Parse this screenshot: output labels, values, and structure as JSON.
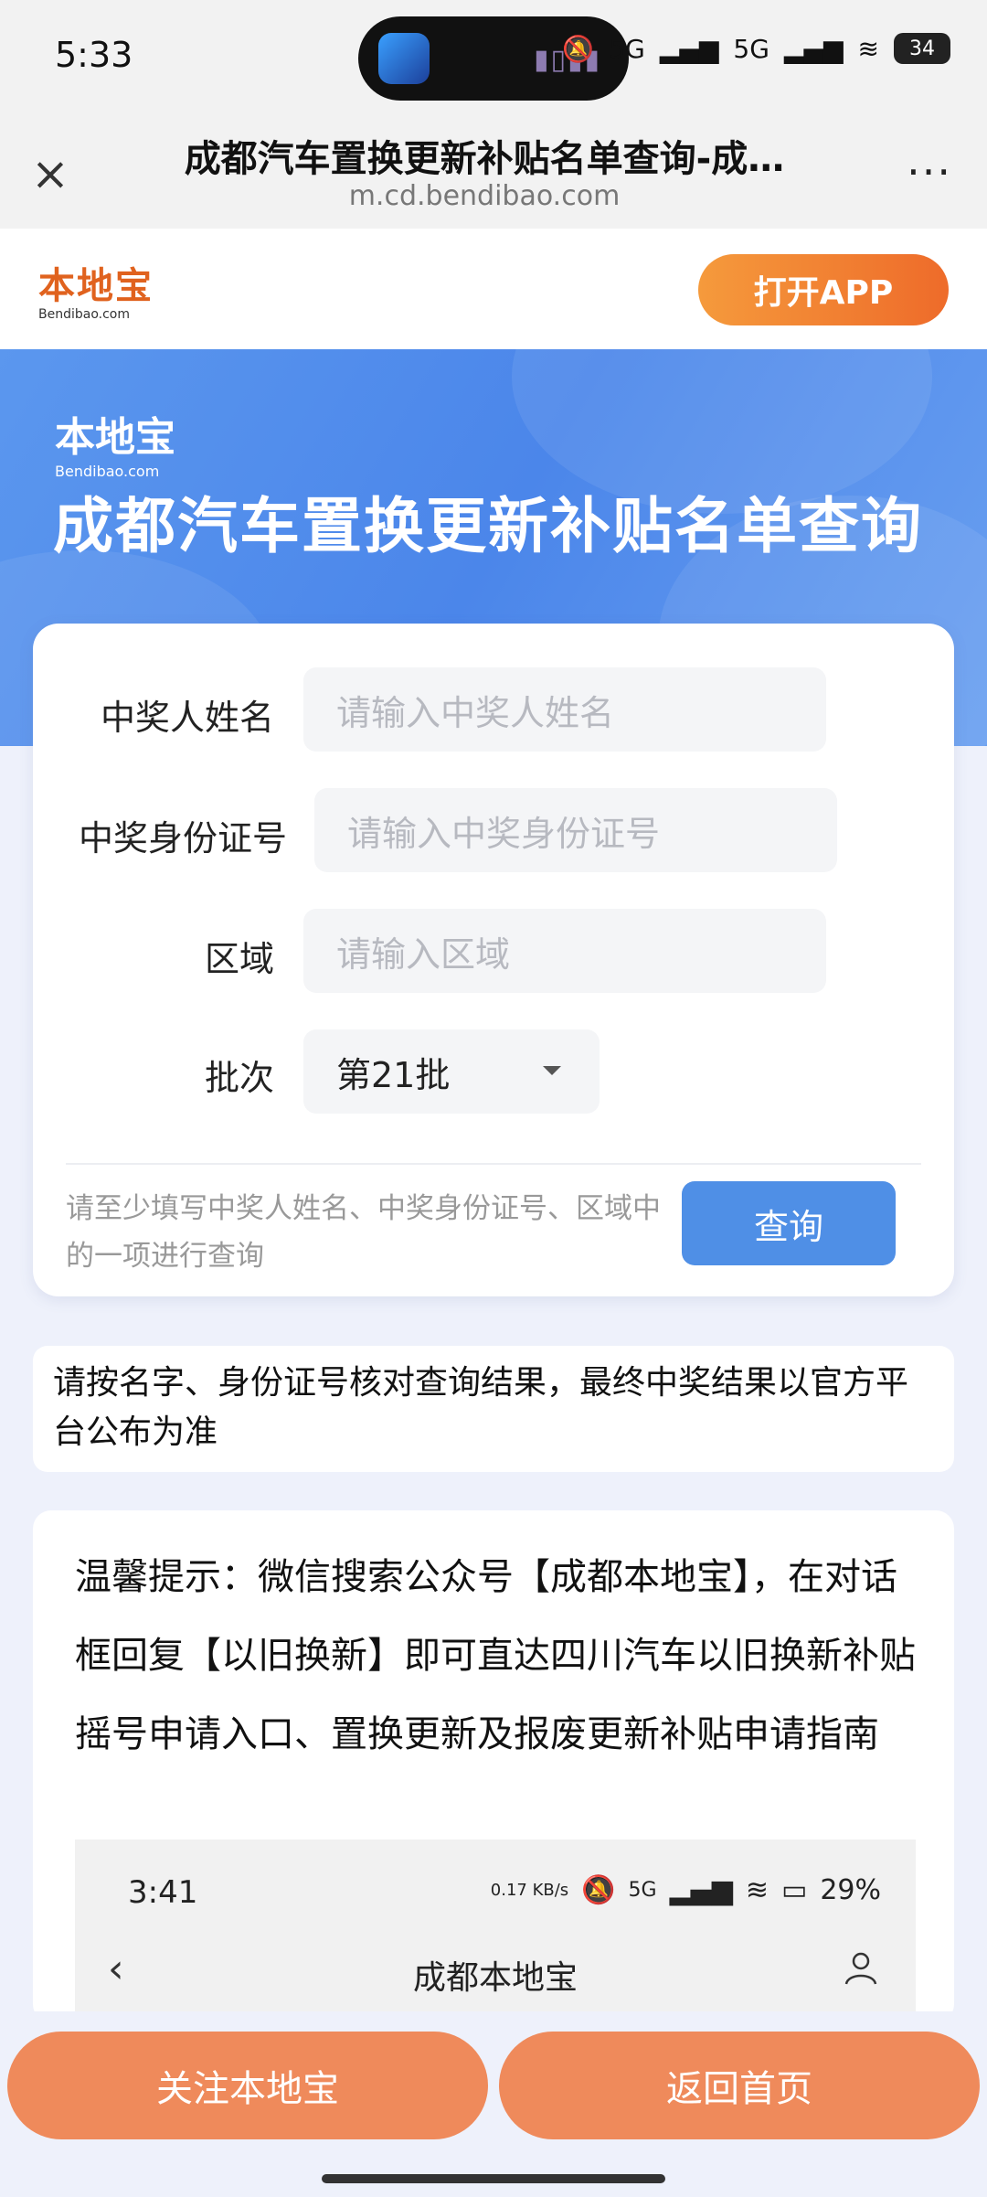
{
  "status_bar": {
    "time": "5:33",
    "signal1": "5G",
    "signal2": "5G",
    "battery": "34"
  },
  "browser": {
    "title": "成都汽车置换更新补贴名单查询-成…",
    "domain": "m.cd.bendibao.com"
  },
  "site": {
    "logo_cn": "本地宝",
    "logo_en": "Bendibao.com",
    "open_app": "打开APP"
  },
  "banner": {
    "logo_cn": "本地宝",
    "logo_en": "Bendibao.com",
    "title": "成都汽车置换更新补贴名单查询"
  },
  "form": {
    "name_label": "中奖人姓名",
    "name_placeholder": "请输入中奖人姓名",
    "id_label": "中奖身份证号",
    "id_placeholder": "请输入中奖身份证号",
    "area_label": "区域",
    "area_placeholder": "请输入区域",
    "batch_label": "批次",
    "batch_value": "第21批",
    "hint": "请至少填写中奖人姓名、中奖身份证号、区域中的一项进行查询",
    "query_button": "查询"
  },
  "notice": "请按名字、身份证号核对查询结果，最终中奖结果以官方平台公布为准",
  "tip": {
    "text": "温馨提示：微信搜索公众号【成都本地宝】，在对话框回复【以旧换新】即可直达四川汽车以旧换新补贴摇号申请入口、置换更新及报废更新补贴申请指南",
    "shot_time": "3:41",
    "shot_speed": "0.17 KB/s",
    "shot_signal": "5G",
    "shot_battery": "29%",
    "shot_title": "成都本地宝"
  },
  "bottom": {
    "follow": "关注本地宝",
    "home": "返回首页"
  }
}
